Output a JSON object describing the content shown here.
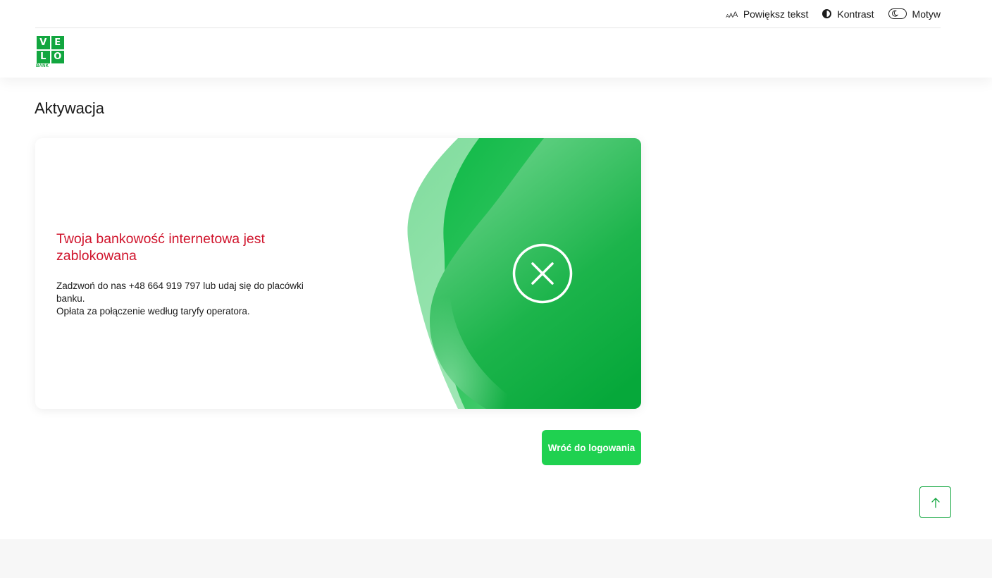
{
  "topbar": {
    "enlarge_text": "Powiększ tekst",
    "enlarge_icon_letters": [
      "A",
      "A",
      "A"
    ],
    "contrast": "Kontrast",
    "theme": "Motyw"
  },
  "logo": {
    "letters": [
      "V",
      "E",
      "L",
      "O"
    ],
    "word": "BANK"
  },
  "page": {
    "title": "Aktywacja"
  },
  "card": {
    "title": "Twoja bankowość internetowa jest zablokowana",
    "desc_line1": "Zadzwoń do nas +48 664 919 797 lub udaj się do placówki banku.",
    "desc_line2": "Opłata za połączenie według taryfy operatora.",
    "status_icon": "close-circle-icon"
  },
  "actions": {
    "back_label": "Wróć do logowania",
    "scroll_top_icon": "arrow-up-icon"
  },
  "colors": {
    "brand_green": "#12a63f",
    "button_green": "#1fd150",
    "error_red": "#d0142c"
  }
}
